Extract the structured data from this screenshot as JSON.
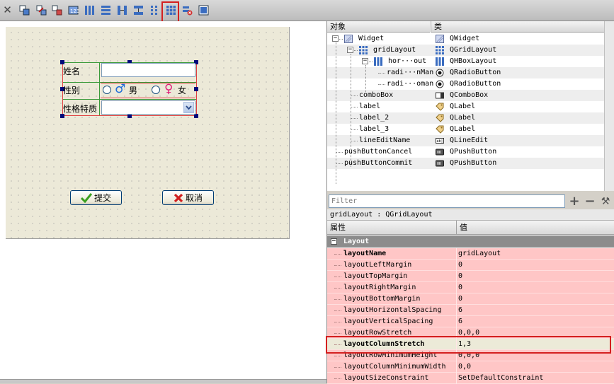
{
  "toolbar": {
    "icons": [
      "close-icon",
      "edit-widgets-icon",
      "edit-signals-icon",
      "edit-buddies-icon",
      "edit-tab-order-icon",
      "layout-horizontal-icon",
      "layout-vertical-icon",
      "layout-horizontal-splitter-icon",
      "layout-vertical-splitter-icon",
      "layout-form-icon",
      "layout-grid-icon",
      "break-layout-icon",
      "adjust-size-icon"
    ]
  },
  "form": {
    "name_label": "姓名",
    "gender_label": "性别",
    "male_label": "男",
    "female_label": "女",
    "male_symbol": "♂",
    "female_symbol": "♀",
    "trait_label": "性格特质",
    "submit_label": "提交",
    "cancel_label": "取消"
  },
  "object_inspector": {
    "col_object": "对象",
    "col_class": "类",
    "rows": [
      {
        "name": "Widget",
        "type": "QWidget"
      },
      {
        "name": "gridLayout",
        "type": "QGridLayout"
      },
      {
        "name": "hor···out",
        "type": "QHBoxLayout"
      },
      {
        "name": "radi···nMan",
        "type": "QRadioButton"
      },
      {
        "name": "radi···oman",
        "type": "QRadioButton"
      },
      {
        "name": "comboBox",
        "type": "QComboBox"
      },
      {
        "name": "label",
        "type": "QLabel"
      },
      {
        "name": "label_2",
        "type": "QLabel"
      },
      {
        "name": "label_3",
        "type": "QLabel"
      },
      {
        "name": "lineEditName",
        "type": "QLineEdit"
      },
      {
        "name": "pushButtonCancel",
        "type": "QPushButton"
      },
      {
        "name": "pushButtonCommit",
        "type": "QPushButton"
      }
    ]
  },
  "filter": {
    "placeholder": "Filter"
  },
  "property_editor": {
    "object_line": "gridLayout : QGridLayout",
    "col_property": "属性",
    "col_value": "值",
    "group": "Layout",
    "rows": [
      {
        "name": "layoutName",
        "value": "gridLayout"
      },
      {
        "name": "layoutLeftMargin",
        "value": "0"
      },
      {
        "name": "layoutTopMargin",
        "value": "0"
      },
      {
        "name": "layoutRightMargin",
        "value": "0"
      },
      {
        "name": "layoutBottomMargin",
        "value": "0"
      },
      {
        "name": "layoutHorizontalSpacing",
        "value": "6"
      },
      {
        "name": "layoutVerticalSpacing",
        "value": "6"
      },
      {
        "name": "layoutRowStretch",
        "value": "0,0,0"
      },
      {
        "name": "layoutColumnStretch",
        "value": "1,3"
      },
      {
        "name": "layoutRowMinimumHeight",
        "value": "0,0,0"
      },
      {
        "name": "layoutColumnMinimumWidth",
        "value": "0,0"
      },
      {
        "name": "layoutSizeConstraint",
        "value": "SetDefaultConstraint"
      }
    ]
  },
  "colors": {
    "highlight": "#d42020",
    "property_row": "#ffc6c6",
    "group_header": "#8c8c8c"
  }
}
